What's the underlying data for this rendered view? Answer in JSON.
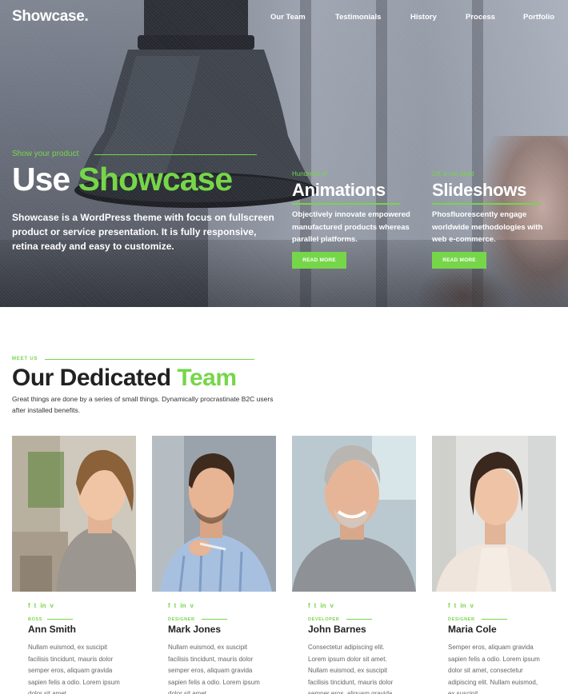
{
  "header": {
    "logo": "Showcase.",
    "nav": [
      "Our Team",
      "Testimonials",
      "History",
      "Process",
      "Portfolio"
    ]
  },
  "hero": {
    "kicker": "Show your product",
    "title_part1": "Use ",
    "title_part2": "Showcase",
    "description": "Showcase is a WordPress theme with focus on fullscreen product or service presentation. It is fully responsive, retina ready and easy to customize.",
    "features": [
      {
        "kicker": "Hundreds of",
        "title": "Animations",
        "description": "Objectively innovate empowered manufactured products whereas parallel platforms.",
        "button": "READ MORE"
      },
      {
        "kicker": "UX is not dead",
        "title": "Slideshows",
        "description": "Phosfluorescently engage worldwide methodologies with web e-commerce.",
        "button": "READ MORE"
      }
    ]
  },
  "team": {
    "label": "MEET US",
    "heading_part1": "Our Dedicated ",
    "heading_part2": "Team",
    "intro": "Great things are done by a series of small things. Dynamically procrastinate B2C users after installed benefits.",
    "members": [
      {
        "role": "BOSS",
        "name": "Ann Smith",
        "bio": "Nullam euismod, ex suscipit facilisis tincidunt, mauris dolor semper eros, aliquam gravida sapien felis a odio. Lorem ipsum dolor sit amet."
      },
      {
        "role": "DESIGNER",
        "name": "Mark Jones",
        "bio": "Nullam euismod, ex suscipit facilisis tincidunt, mauris dolor semper eros, aliquam gravida sapien felis a odio. Lorem ipsum dolor sit amet."
      },
      {
        "role": "DEVELOPER",
        "name": "John Barnes",
        "bio": "Consectetur adipiscing elit. Lorem ipsum dolor sit amet. Nullam euismod, ex suscipit facilisis tincidunt, mauris dolor semper eros, aliquam gravida."
      },
      {
        "role": "DESIGNER",
        "name": "Maria Cole",
        "bio": "Semper eros, aliquam gravida sapien felis a odio. Lorem ipsum dolor sit amet, consectetur adipiscing elit. Nullam euismod, ex suscipit."
      }
    ],
    "social_icons": [
      "f",
      "t",
      "in",
      "v"
    ]
  },
  "colors": {
    "accent": "#76d649",
    "heading": "#222222",
    "body_text": "#666666"
  }
}
